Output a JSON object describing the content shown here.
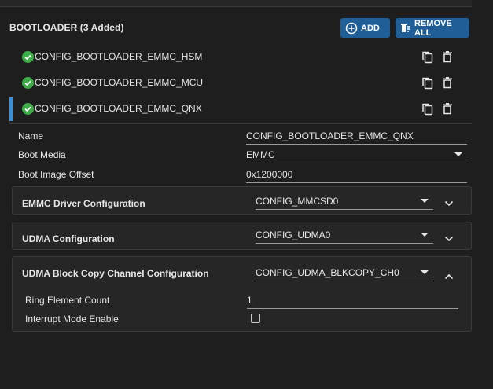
{
  "bootloader": {
    "title": "BOOTLOADER (3 Added)",
    "add_label": "ADD",
    "remove_all_label": "REMOVE ALL",
    "items": [
      {
        "label": "CONFIG_BOOTLOADER_EMMC_HSM",
        "active": false
      },
      {
        "label": "CONFIG_BOOTLOADER_EMMC_MCU",
        "active": false
      },
      {
        "label": "CONFIG_BOOTLOADER_EMMC_QNX",
        "active": true
      }
    ]
  },
  "properties": {
    "name_label": "Name",
    "name_value": "CONFIG_BOOTLOADER_EMMC_QNX",
    "boot_media_label": "Boot Media",
    "boot_media_value": "EMMC",
    "boot_offset_label": "Boot Image Offset",
    "boot_offset_value": "0x1200000"
  },
  "sections": {
    "emmc": {
      "title": "EMMC Driver Configuration",
      "value": "CONFIG_MMCSD0",
      "expanded": false
    },
    "udma": {
      "title": "UDMA Configuration",
      "value": "CONFIG_UDMA0",
      "expanded": false
    },
    "udma_blk": {
      "title": "UDMA Block Copy Channel Configuration",
      "value": "CONFIG_UDMA_BLKCOPY_CH0",
      "expanded": true,
      "ring_label": "Ring Element Count",
      "ring_value": "1",
      "interrupt_label": "Interrupt Mode Enable",
      "interrupt_checked": false
    }
  },
  "colors": {
    "accent": "#1f5e96",
    "check_green": "#3fae49",
    "active_bar": "#3a8fd8"
  }
}
